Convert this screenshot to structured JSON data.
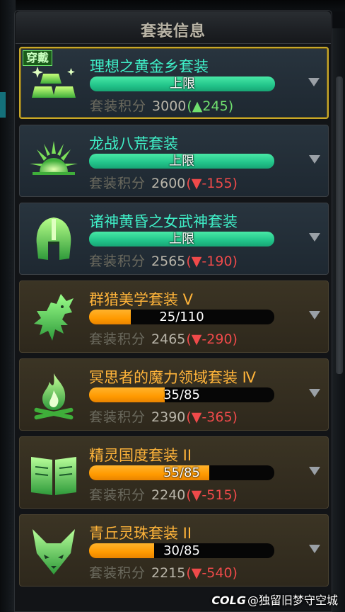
{
  "header": {
    "title": "套装信息"
  },
  "badge_label": "穿戴",
  "score_label": "套装积分",
  "sets": [
    {
      "name": "理想之黄金乡套装",
      "name_color": "green",
      "progress_text": "上限",
      "progress": 1.0,
      "score": "3000",
      "delta_prefix": "(",
      "delta_arrow": "▲",
      "delta_value": "245",
      "delta_suffix": ")",
      "delta_dir": "up",
      "icon": "gold-bars-icon",
      "equipped": true,
      "theme": "blue"
    },
    {
      "name": "龙战八荒套装",
      "name_color": "green",
      "progress_text": "上限",
      "progress": 1.0,
      "score": "2600",
      "delta_prefix": "(",
      "delta_arrow": "▼",
      "delta_value": "-155",
      "delta_suffix": ")",
      "delta_dir": "down",
      "icon": "rising-sun-icon",
      "equipped": false,
      "theme": "blue"
    },
    {
      "name": "诸神黄昏之女武神套装",
      "name_color": "green",
      "progress_text": "上限",
      "progress": 1.0,
      "score": "2565",
      "delta_prefix": "(",
      "delta_arrow": "▼",
      "delta_value": "-190",
      "delta_suffix": ")",
      "delta_dir": "down",
      "icon": "spartan-helmet-icon",
      "equipped": false,
      "theme": "blue"
    },
    {
      "name": "群猎美学套装 V",
      "name_color": "orange",
      "progress_text": "25/110",
      "progress": 0.227,
      "score": "2465",
      "delta_prefix": "(",
      "delta_arrow": "▼",
      "delta_value": "-290",
      "delta_suffix": ")",
      "delta_dir": "down",
      "icon": "howling-wolf-icon",
      "equipped": false,
      "theme": "gold"
    },
    {
      "name": "冥思者的魔力领域套装 Ⅳ",
      "name_color": "orange",
      "progress_text": "35/85",
      "progress": 0.41,
      "score": "2390",
      "delta_prefix": "(",
      "delta_arrow": "▼",
      "delta_value": "-365",
      "delta_suffix": ")",
      "delta_dir": "down",
      "icon": "campfire-icon",
      "equipped": false,
      "theme": "gold"
    },
    {
      "name": "精灵国度套装 II",
      "name_color": "orange",
      "progress_text": "55/85",
      "progress": 0.647,
      "score": "2240",
      "delta_prefix": "(",
      "delta_arrow": "▼",
      "delta_value": "-515",
      "delta_suffix": ")",
      "delta_dir": "down",
      "icon": "open-book-icon",
      "equipped": false,
      "theme": "gold"
    },
    {
      "name": "青丘灵珠套装 II",
      "name_color": "orange",
      "progress_text": "30/85",
      "progress": 0.353,
      "score": "2215",
      "delta_prefix": "(",
      "delta_arrow": "▼",
      "delta_value": "-540",
      "delta_suffix": ")",
      "delta_dir": "down",
      "icon": "fox-head-icon",
      "equipped": false,
      "theme": "gold"
    }
  ],
  "watermark": {
    "logo": "COLG",
    "text": "@独留旧梦守空城"
  }
}
